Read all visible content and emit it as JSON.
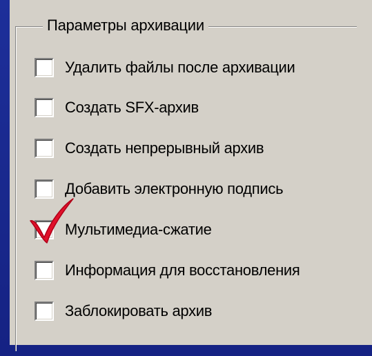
{
  "group": {
    "title": "Параметры архивации"
  },
  "options": [
    {
      "label": "Удалить файлы после архивации",
      "checked": false
    },
    {
      "label": "Создать SFX-архив",
      "checked": false
    },
    {
      "label": "Создать непрерывный архив",
      "checked": false
    },
    {
      "label": "Добавить электронную подпись",
      "checked": false
    },
    {
      "label": "Мультимедиа-сжатие",
      "checked": true
    },
    {
      "label": "Информация для восстановления",
      "checked": false
    },
    {
      "label": "Заблокировать архив",
      "checked": false
    }
  ],
  "colors": {
    "background": "#1a2a90",
    "panel": "#d4d0c8",
    "check_mark": "#e0102a"
  }
}
